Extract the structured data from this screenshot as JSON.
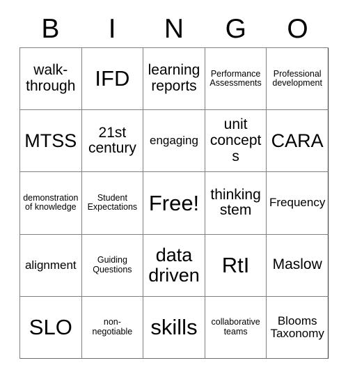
{
  "card": {
    "type": "bingo-card",
    "header_letters": [
      "B",
      "I",
      "N",
      "G",
      "O"
    ],
    "columns": 5,
    "rows": 5,
    "free_space": "Free!",
    "colors": {
      "background": "#ffffff",
      "text": "#000000",
      "grid_line": "#808080",
      "outer_edge": "#2b2b2b"
    },
    "cells": [
      {
        "text": "walk-through",
        "size": "md"
      },
      {
        "text": "IFD",
        "size": "xl"
      },
      {
        "text": "learning reports",
        "size": "md"
      },
      {
        "text": "Performance Assessments",
        "size": "xs"
      },
      {
        "text": "Professional development",
        "size": "xs"
      },
      {
        "text": "MTSS",
        "size": "lg"
      },
      {
        "text": "21st century",
        "size": "md"
      },
      {
        "text": "engaging",
        "size": "sm"
      },
      {
        "text": "unit concepts",
        "size": "md"
      },
      {
        "text": "CARA",
        "size": "lg"
      },
      {
        "text": "demonstration of knowledge",
        "size": "xs"
      },
      {
        "text": "Student Expectations",
        "size": "xs"
      },
      {
        "text": "Free!",
        "size": "xl"
      },
      {
        "text": "thinking stem",
        "size": "md"
      },
      {
        "text": "Frequency",
        "size": "sm"
      },
      {
        "text": "alignment",
        "size": "sm"
      },
      {
        "text": "Guiding Questions",
        "size": "xs"
      },
      {
        "text": "data driven",
        "size": "lg"
      },
      {
        "text": "RtI",
        "size": "xl"
      },
      {
        "text": "Maslow",
        "size": "md"
      },
      {
        "text": "SLO",
        "size": "xl"
      },
      {
        "text": "non-negotiable",
        "size": "xs"
      },
      {
        "text": "skills",
        "size": "xl"
      },
      {
        "text": "collaborative teams",
        "size": "xs"
      },
      {
        "text": "Blooms Taxonomy",
        "size": "sm"
      }
    ]
  }
}
